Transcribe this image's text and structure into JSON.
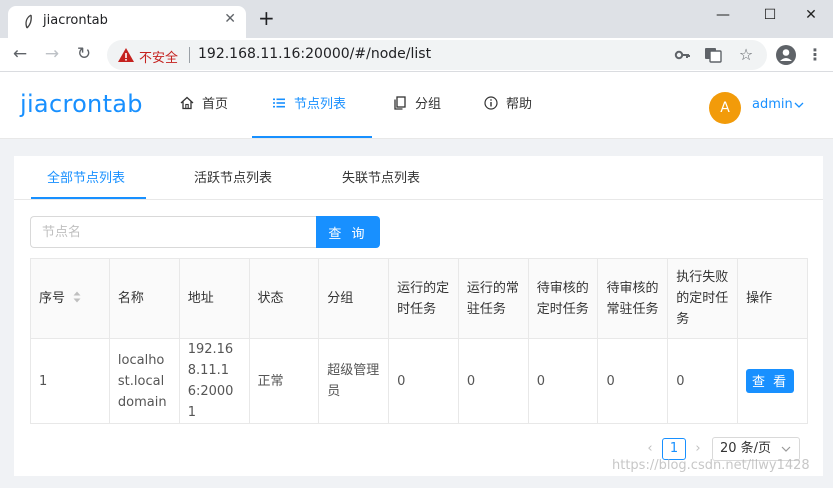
{
  "browser": {
    "tab_title": "jiacrontab",
    "new_tab_icon": "plus-icon",
    "security_label": "不安全",
    "url": "192.168.11.16:20000/#/node/list"
  },
  "header": {
    "logo": "jiacrontab",
    "nav": [
      {
        "label": "首页",
        "icon": "home-icon"
      },
      {
        "label": "节点列表",
        "icon": "list-icon",
        "active": true
      },
      {
        "label": "分组",
        "icon": "copy-icon"
      },
      {
        "label": "帮助",
        "icon": "info-icon"
      }
    ],
    "avatar_letter": "A",
    "user": "admin"
  },
  "tabs": [
    "全部节点列表",
    "活跃节点列表",
    "失联节点列表"
  ],
  "search": {
    "placeholder": "节点名",
    "button": "查 询"
  },
  "table": {
    "columns": [
      "序号",
      "名称",
      "地址",
      "状态",
      "分组",
      "运行的定时任务",
      "运行的常驻任务",
      "待审核的定时任务",
      "待审核的常驻任务",
      "执行失败的定时任务",
      "操作"
    ],
    "rows": [
      {
        "index": "1",
        "name": "localhost.localdomain",
        "addr": "192.168.11.16:20001",
        "status": "正常",
        "group": "超级管理员",
        "timer_running": "0",
        "daemon_running": "0",
        "timer_audit": "0",
        "daemon_audit": "0",
        "timer_failed": "0",
        "action": "查 看"
      }
    ]
  },
  "pagination": {
    "current": "1",
    "page_size": "20 条/页",
    "prev": "‹",
    "next": "›"
  },
  "watermark": "https://blog.csdn.net/llwy1428",
  "colors": {
    "primary": "#1890ff",
    "success": "#52c41a",
    "avatar": "#f29b0a",
    "insecure": "#c5221f"
  }
}
